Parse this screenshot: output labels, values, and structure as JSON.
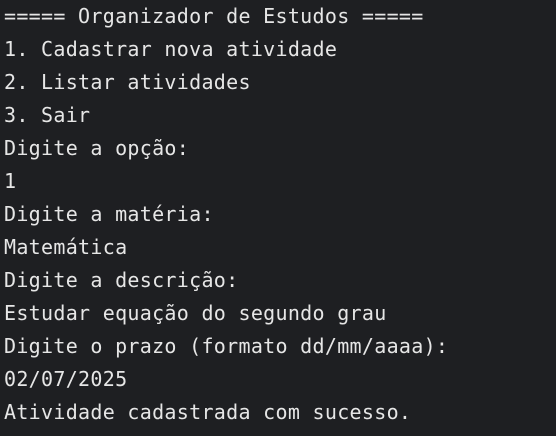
{
  "terminal": {
    "lines": [
      "===== Organizador de Estudos =====",
      "1. Cadastrar nova atividade",
      "2. Listar atividades",
      "3. Sair",
      "Digite a opção:",
      "1",
      "Digite a matéria:",
      "Matemática",
      "Digite a descrição:",
      "Estudar equação do segundo grau",
      "Digite o prazo (formato dd/mm/aaaa):",
      "02/07/2025",
      "Atividade cadastrada com sucesso."
    ]
  }
}
